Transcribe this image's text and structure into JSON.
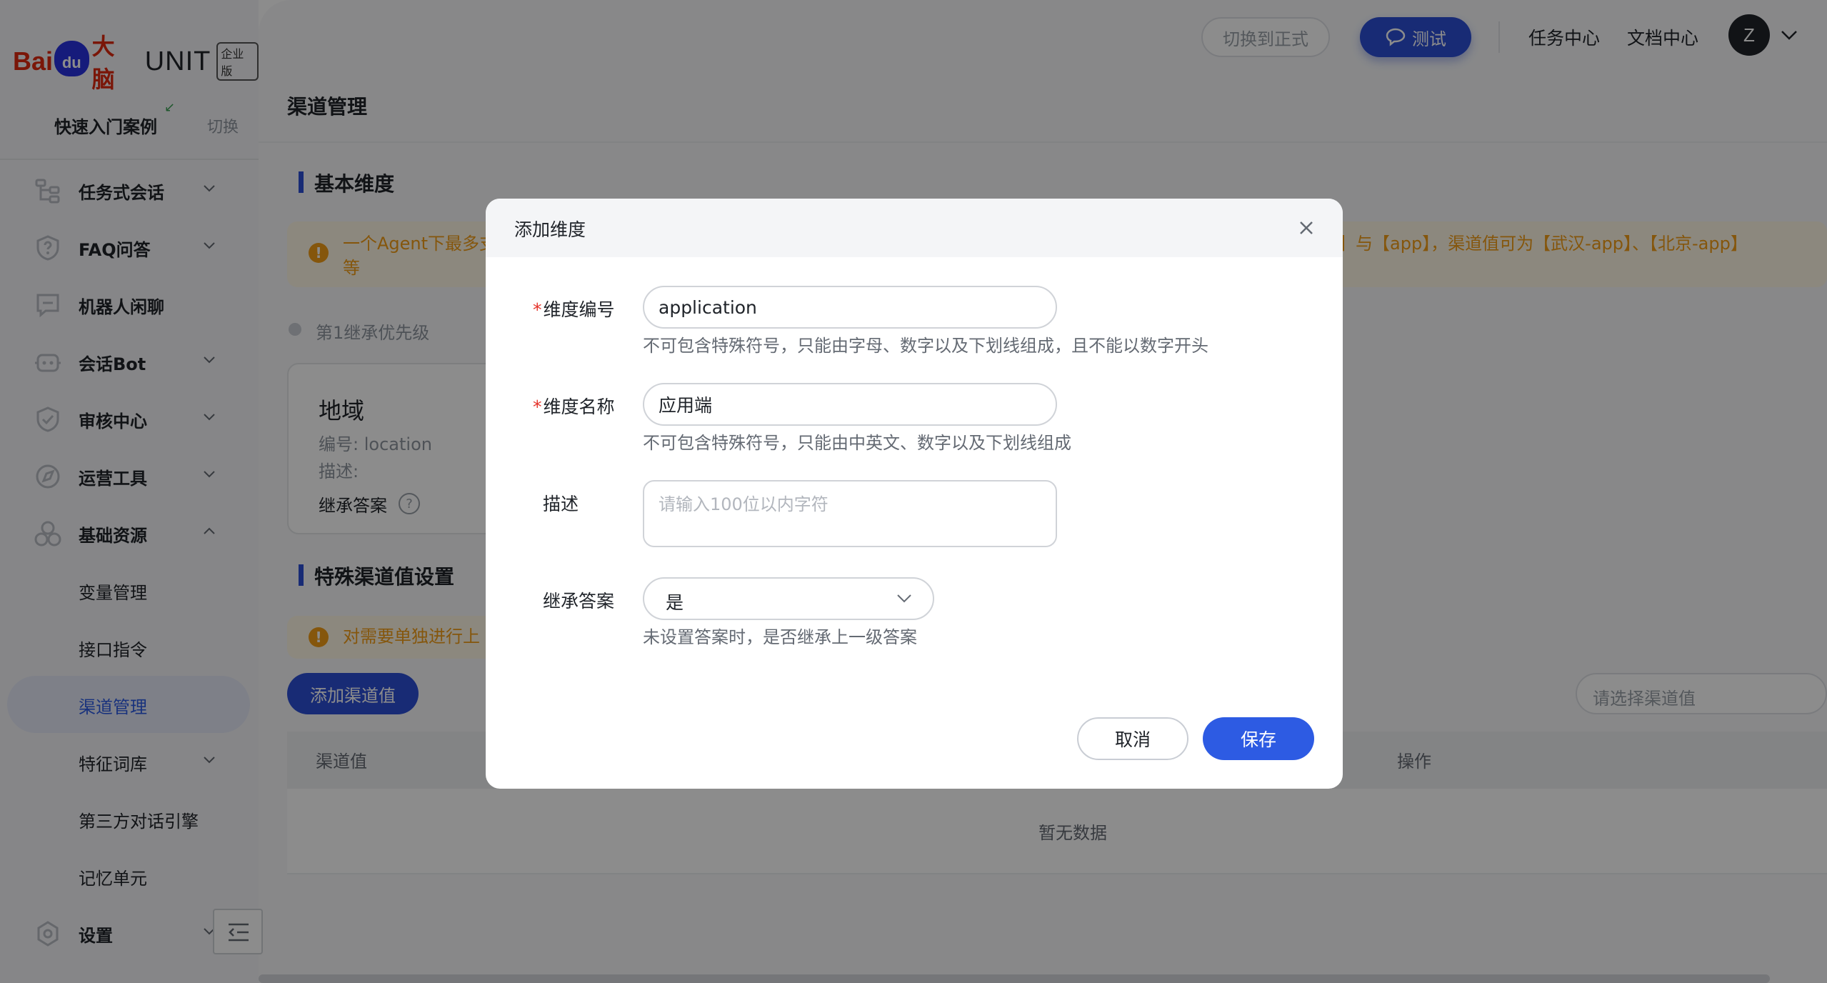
{
  "brand": {
    "logo_bai": "Bai",
    "logo_du": "du",
    "logo_danao": "大脑",
    "logo_unit": "UNIT",
    "logo_edition": "企业版"
  },
  "sidebar": {
    "quick_title": "快速入门案例",
    "quick_switch": "切换",
    "items": [
      {
        "label": "任务式会话",
        "icon": "tree-icon",
        "expand": "down"
      },
      {
        "label": "FAQ问答",
        "icon": "question-shield-icon",
        "expand": "down"
      },
      {
        "label": "机器人闲聊",
        "icon": "chat-icon",
        "expand": "none"
      },
      {
        "label": "会话Bot",
        "icon": "robot-icon",
        "expand": "down"
      },
      {
        "label": "审核中心",
        "icon": "shield-check-icon",
        "expand": "down"
      },
      {
        "label": "运营工具",
        "icon": "compass-icon",
        "expand": "down"
      },
      {
        "label": "基础资源",
        "icon": "cubes-icon",
        "expand": "up"
      },
      {
        "label": "变量管理"
      },
      {
        "label": "接口指令"
      },
      {
        "label": "渠道管理",
        "active": true
      },
      {
        "label": "特征词库",
        "expand": "down"
      },
      {
        "label": "第三方对话引擎"
      },
      {
        "label": "记忆单元"
      },
      {
        "label": "设置",
        "icon": "gear-icon",
        "expand": "down"
      }
    ]
  },
  "topbar": {
    "switch_formal": "切换到正式",
    "test": "测试",
    "task_center": "任务中心",
    "doc_center": "文档中心",
    "avatar_letter": "Z"
  },
  "page": {
    "title": "渠道管理",
    "basic_section": "基本维度",
    "basic_alert_left": "一个Agent下最多支",
    "basic_alert_left2": "等",
    "basic_alert_right": "】与【app】，渠道值可为【武汉-app】、【北京-app】",
    "priority_label": "第1继承优先级",
    "card": {
      "title": "地域",
      "code_label": "编号:",
      "code_value": "location",
      "desc_label": "描述:",
      "inherit": "继承答案",
      "help": "?"
    },
    "special_section": "特殊渠道值设置",
    "special_alert": "对需要单独进行上",
    "add_channel_button": "添加渠道值",
    "select_channel_placeholder": "请选择渠道值",
    "table": {
      "columns": [
        "渠道值",
        "操作"
      ],
      "empty": "暂无数据"
    }
  },
  "modal": {
    "title": "添加维度",
    "fields": {
      "code": {
        "label": "维度编号",
        "value": "application",
        "help": "不可包含特殊符号，只能由字母、数字以及下划线组成，且不能以数字开头"
      },
      "name": {
        "label": "维度名称",
        "value": "应用端",
        "help": "不可包含特殊符号，只能由中英文、数字以及下划线组成"
      },
      "desc": {
        "label": "描述",
        "placeholder": "请输入100位以内字符"
      },
      "inherit": {
        "label": "继承答案",
        "value": "是",
        "help": "未设置答案时，是否继承上一级答案"
      }
    },
    "cancel": "取消",
    "save": "保存"
  },
  "colors": {
    "primary": "#2d5be3",
    "alert_text": "#f29d16",
    "alert_bg": "#fff7e6",
    "required": "#e5332a",
    "brand_red": "#de2910",
    "brand_blue": "#2932e1"
  }
}
